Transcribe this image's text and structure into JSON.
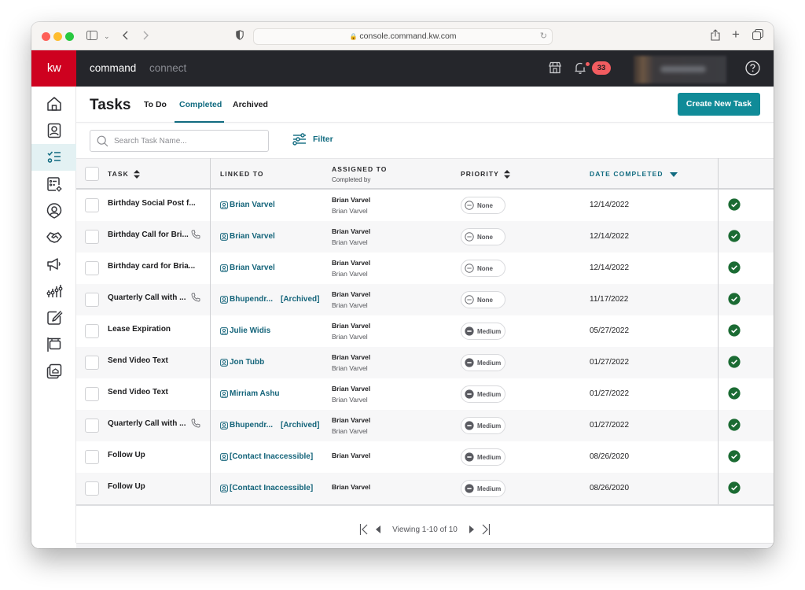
{
  "browser": {
    "url": "console.command.kw.com"
  },
  "appbar": {
    "logo": "kw",
    "tabs": [
      {
        "label": "command",
        "active": true
      },
      {
        "label": "connect",
        "active": false
      }
    ],
    "notification_count": "33",
    "icons": [
      "storefront-icon",
      "bell-icon",
      "help-icon"
    ]
  },
  "sidebar": {
    "items": [
      {
        "name": "home",
        "icon": "home-icon"
      },
      {
        "name": "contacts",
        "icon": "contact-card-icon"
      },
      {
        "name": "tasks",
        "icon": "checklist-icon",
        "active": true
      },
      {
        "name": "task-settings",
        "icon": "list-settings-icon"
      },
      {
        "name": "profile",
        "icon": "user-pin-icon"
      },
      {
        "name": "opportunities",
        "icon": "handshake-icon"
      },
      {
        "name": "marketing",
        "icon": "megaphone-icon"
      },
      {
        "name": "insights",
        "icon": "bar-chart-icon"
      },
      {
        "name": "designs",
        "icon": "edit-brush-icon"
      },
      {
        "name": "listings",
        "icon": "sign-post-icon"
      },
      {
        "name": "collections",
        "icon": "photo-stack-icon"
      }
    ]
  },
  "page": {
    "title": "Tasks",
    "tabs": [
      {
        "label": "To Do",
        "active": false
      },
      {
        "label": "Completed",
        "active": true
      },
      {
        "label": "Archived",
        "active": false
      }
    ],
    "create_button": "Create New Task",
    "search_placeholder": "Search Task Name...",
    "filter_label": "Filter"
  },
  "table": {
    "columns": {
      "task": "TASK",
      "linked_to": "LINKED TO",
      "assigned_to": "ASSIGNED TO",
      "completed_by": "Completed by",
      "priority": "PRIORITY",
      "date_completed": "DATE COMPLETED"
    },
    "sort": {
      "column": "date_completed",
      "direction": "desc"
    },
    "rows": [
      {
        "task": "Birthday Social Post f...",
        "phone": false,
        "linked": "Brian Varvel",
        "archived": "",
        "assigned": "Brian Varvel",
        "completed_by": "Brian Varvel",
        "priority": "None",
        "date": "12/14/2022",
        "done": true
      },
      {
        "task": "Birthday Call for Bri...",
        "phone": true,
        "linked": "Brian Varvel",
        "archived": "",
        "assigned": "Brian Varvel",
        "completed_by": "Brian Varvel",
        "priority": "None",
        "date": "12/14/2022",
        "done": true
      },
      {
        "task": "Birthday card for Bria...",
        "phone": false,
        "linked": "Brian Varvel",
        "archived": "",
        "assigned": "Brian Varvel",
        "completed_by": "Brian Varvel",
        "priority": "None",
        "date": "12/14/2022",
        "done": true
      },
      {
        "task": "Quarterly Call with ...",
        "phone": true,
        "linked": "Bhupendr...",
        "archived": "[Archived]",
        "assigned": "Brian Varvel",
        "completed_by": "Brian Varvel",
        "priority": "None",
        "date": "11/17/2022",
        "done": true
      },
      {
        "task": "Lease Expiration",
        "phone": false,
        "linked": "Julie Widis",
        "archived": "",
        "assigned": "Brian Varvel",
        "completed_by": "Brian Varvel",
        "priority": "Medium",
        "date": "05/27/2022",
        "done": true
      },
      {
        "task": "Send Video Text",
        "phone": false,
        "linked": "Jon Tubb",
        "archived": "",
        "assigned": "Brian Varvel",
        "completed_by": "Brian Varvel",
        "priority": "Medium",
        "date": "01/27/2022",
        "done": true
      },
      {
        "task": "Send Video Text",
        "phone": false,
        "linked": "Mirriam Ashu",
        "archived": "",
        "assigned": "Brian Varvel",
        "completed_by": "Brian Varvel",
        "priority": "Medium",
        "date": "01/27/2022",
        "done": true
      },
      {
        "task": "Quarterly Call with ...",
        "phone": true,
        "linked": "Bhupendr...",
        "archived": "[Archived]",
        "assigned": "Brian Varvel",
        "completed_by": "Brian Varvel",
        "priority": "Medium",
        "date": "01/27/2022",
        "done": true
      },
      {
        "task": "Follow Up",
        "phone": false,
        "linked": "[Contact Inaccessible]",
        "archived": "",
        "assigned": "Brian Varvel",
        "completed_by": "",
        "priority": "Medium",
        "date": "08/26/2020",
        "done": true
      },
      {
        "task": "Follow Up",
        "phone": false,
        "linked": "[Contact Inaccessible]",
        "archived": "",
        "assigned": "Brian Varvel",
        "completed_by": "",
        "priority": "Medium",
        "date": "08/26/2020",
        "done": true
      }
    ]
  },
  "pagination": {
    "label": "Viewing 1-10 of 10"
  },
  "colors": {
    "brand_red": "#ce011f",
    "accent_teal": "#116b80",
    "button_teal": "#108b98",
    "success_green": "#1b6b33",
    "badge_red": "#f25c60"
  }
}
